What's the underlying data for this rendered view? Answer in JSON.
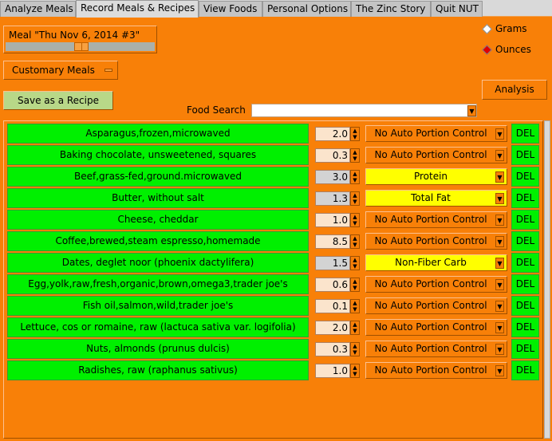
{
  "tabs": [
    "Analyze Meals",
    "Record Meals & Recipes",
    "View Foods",
    "Personal Options",
    "The Zinc Story",
    "Quit NUT"
  ],
  "active_tab": 1,
  "meal_label": "Meal \"Thu Nov  6, 2014 #3\"",
  "meal_slider_position": 0.5,
  "customary_meals": "Customary Meals",
  "save_recipe": "Save as a Recipe",
  "units": {
    "grams": "Grams",
    "ounces": "Ounces",
    "selected": "Ounces"
  },
  "analysis": "Analysis",
  "food_search_label": "Food Search",
  "food_search_value": "",
  "del_label": "DEL",
  "colors": {
    "background": "#f88008",
    "food_button": "#00f000",
    "portion_active": "#ffff00"
  },
  "rows": [
    {
      "food": "Asparagus,frozen,microwaved",
      "qty": "2.0",
      "portion": "No Auto Portion Control",
      "auto": false
    },
    {
      "food": "Baking chocolate, unsweetened, squares",
      "qty": "0.3",
      "portion": "No Auto Portion Control",
      "auto": false
    },
    {
      "food": "Beef,grass-fed,ground.microwaved",
      "qty": "3.0",
      "portion": "Protein",
      "auto": true
    },
    {
      "food": "Butter, without salt",
      "qty": "1.3",
      "portion": "Total Fat",
      "auto": true
    },
    {
      "food": "Cheese, cheddar",
      "qty": "1.0",
      "portion": "No Auto Portion Control",
      "auto": false
    },
    {
      "food": "Coffee,brewed,steam espresso,homemade",
      "qty": "8.5",
      "portion": "No Auto Portion Control",
      "auto": false
    },
    {
      "food": "Dates, deglet noor (phoenix dactylifera)",
      "qty": "1.5",
      "portion": "Non-Fiber Carb",
      "auto": true
    },
    {
      "food": "Egg,yolk,raw,fresh,organic,brown,omega3,trader joe's",
      "qty": "0.6",
      "portion": "No Auto Portion Control",
      "auto": false
    },
    {
      "food": "Fish oil,salmon,wild,trader joe's",
      "qty": "0.1",
      "portion": "No Auto Portion Control",
      "auto": false
    },
    {
      "food": "Lettuce, cos or romaine, raw (lactuca sativa var. logifolia)",
      "qty": "2.0",
      "portion": "No Auto Portion Control",
      "auto": false
    },
    {
      "food": "Nuts, almonds (prunus dulcis)",
      "qty": "0.3",
      "portion": "No Auto Portion Control",
      "auto": false
    },
    {
      "food": "Radishes, raw (raphanus sativus)",
      "qty": "1.0",
      "portion": "No Auto Portion Control",
      "auto": false
    }
  ]
}
